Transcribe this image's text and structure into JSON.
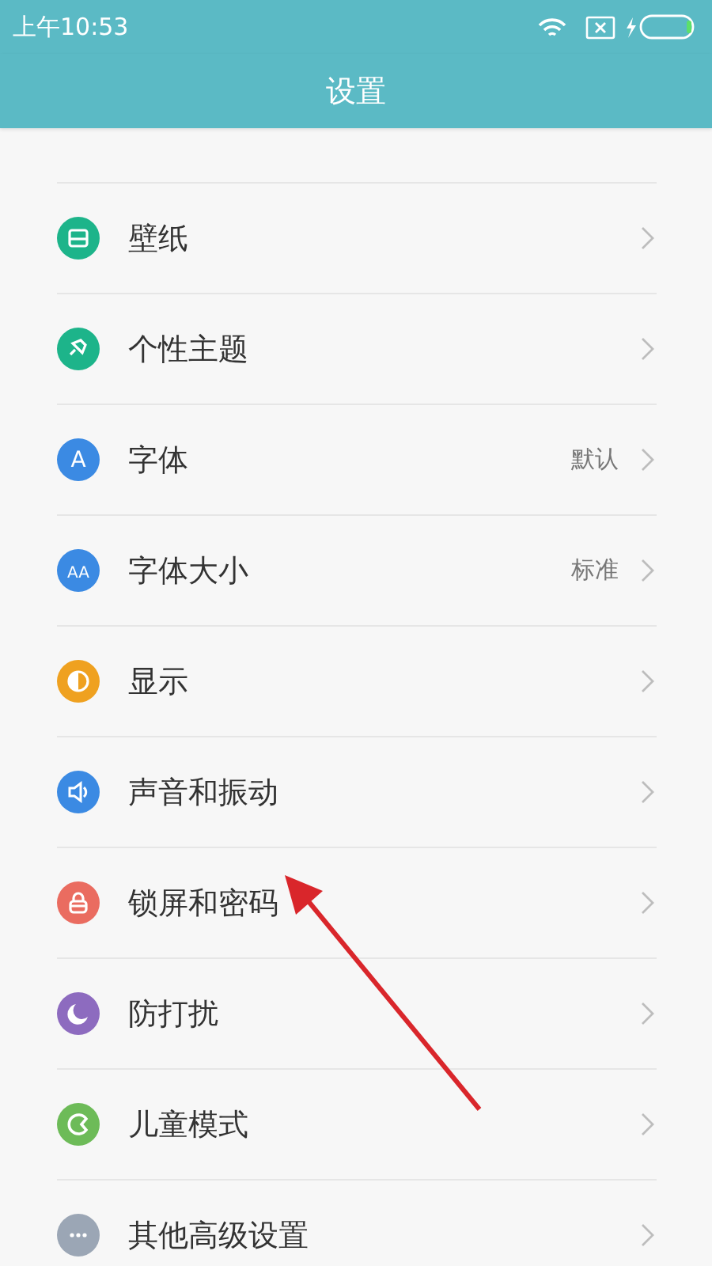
{
  "status_bar": {
    "time": "上午10:53"
  },
  "header": {
    "title": "设置"
  },
  "items": [
    {
      "label": "壁纸",
      "kind": "wallpaper",
      "color": "#1db48a"
    },
    {
      "label": "个性主题",
      "kind": "brush",
      "color": "#1db48a"
    },
    {
      "label": "字体",
      "kind": "letter",
      "icon_text": "A",
      "value": "默认",
      "color": "#3b8ae3"
    },
    {
      "label": "字体大小",
      "kind": "letter",
      "icon_text": "AA",
      "value": "标准",
      "color": "#3b8ae3"
    },
    {
      "label": "显示",
      "kind": "display",
      "color": "#efa120"
    },
    {
      "label": "声音和振动",
      "kind": "speaker",
      "color": "#3b8ae3"
    },
    {
      "label": "锁屏和密码",
      "kind": "lock",
      "color": "#ea6c60"
    },
    {
      "label": "防打扰",
      "kind": "moon",
      "color": "#8d6bbf"
    },
    {
      "label": "儿童模式",
      "kind": "child",
      "color": "#6dbb58"
    },
    {
      "label": "其他高级设置",
      "kind": "more",
      "color": "#9ba6b5"
    }
  ]
}
